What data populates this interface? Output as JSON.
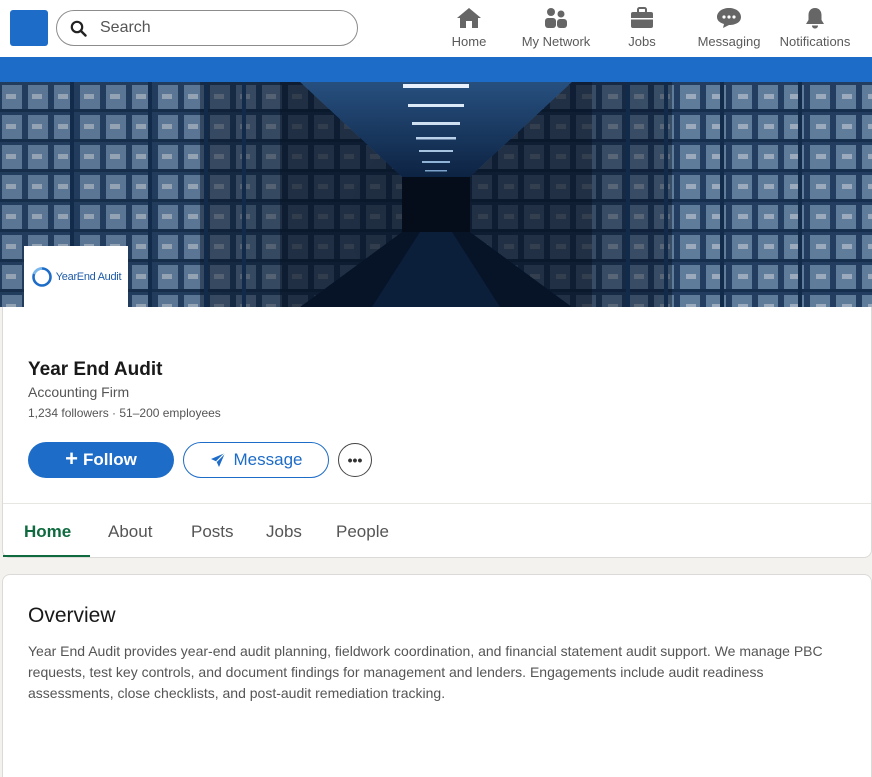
{
  "nav": {
    "search_placeholder": "Search",
    "items": [
      {
        "label": "Home",
        "icon": "home-icon"
      },
      {
        "label": "My Network",
        "icon": "network-icon"
      },
      {
        "label": "Jobs",
        "icon": "briefcase-icon"
      },
      {
        "label": "Messaging",
        "icon": "messaging-icon"
      },
      {
        "label": "Notifications",
        "icon": "bell-icon"
      }
    ]
  },
  "company": {
    "logo_text": "YearEnd Audit",
    "name": "Year End Audit",
    "industry": "Accounting Firm",
    "stats": "1,234 followers · 51–200 employees"
  },
  "actions": {
    "follow": "Follow",
    "message": "Message",
    "more": "•••"
  },
  "tabs": [
    "Home",
    "About",
    "Posts",
    "Jobs",
    "People"
  ],
  "overview": {
    "title": "Overview",
    "text": "Year End Audit provides year-end audit planning, fieldwork coordination, and financial statement audit support. We manage PBC requests, test key controls, and document findings for management and lenders. Engagements include audit readiness assessments, close checklists, and post-audit remediation tracking."
  },
  "colors": {
    "brand_blue": "#1d6cc8",
    "active_tab": "#0f6b3f"
  }
}
